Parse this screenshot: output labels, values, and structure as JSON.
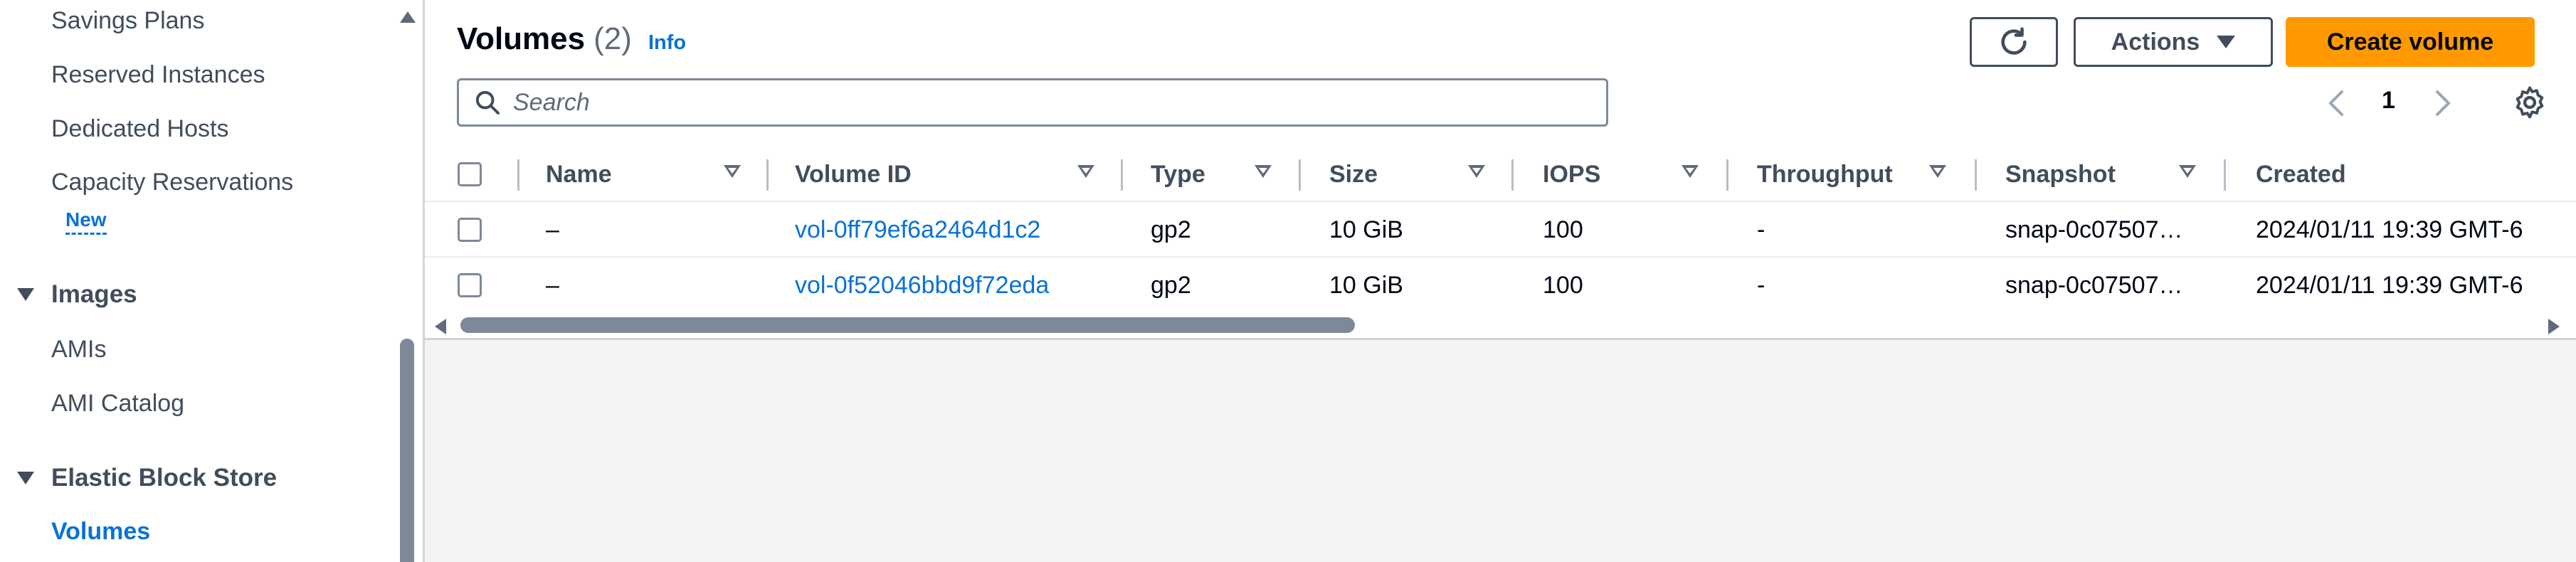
{
  "sidebar": {
    "items": [
      {
        "label": "Savings Plans"
      },
      {
        "label": "Reserved Instances"
      },
      {
        "label": "Dedicated Hosts"
      },
      {
        "label": "Capacity Reservations"
      }
    ],
    "new_badge": "New",
    "sections": [
      {
        "title": "Images",
        "items": [
          {
            "label": "AMIs"
          },
          {
            "label": "AMI Catalog"
          }
        ]
      },
      {
        "title": "Elastic Block Store",
        "items": [
          {
            "label": "Volumes",
            "active": true
          }
        ]
      }
    ]
  },
  "header": {
    "title": "Volumes",
    "count": "(2)",
    "info": "Info",
    "actions_label": "Actions",
    "create_label": "Create volume"
  },
  "search": {
    "placeholder": "Search",
    "value": ""
  },
  "pagination": {
    "current_page": "1"
  },
  "table": {
    "columns": [
      "Name",
      "Volume ID",
      "Type",
      "Size",
      "IOPS",
      "Throughput",
      "Snapshot",
      "Created"
    ],
    "rows": [
      {
        "name": "–",
        "volume_id": "vol-0ff79ef6a2464d1c2",
        "type": "gp2",
        "size": "10 GiB",
        "iops": "100",
        "throughput": "-",
        "snapshot": "snap-0c07507…",
        "created": "2024/01/11 19:39 GMT-6"
      },
      {
        "name": "–",
        "volume_id": "vol-0f52046bbd9f72eda",
        "type": "gp2",
        "size": "10 GiB",
        "iops": "100",
        "throughput": "-",
        "snapshot": "snap-0c07507…",
        "created": "2024/01/11 19:39 GMT-6"
      }
    ]
  },
  "colors": {
    "accent": "#0972d3",
    "primary_button": "#ff9900",
    "text": "#000716",
    "muted": "#414d5c"
  }
}
